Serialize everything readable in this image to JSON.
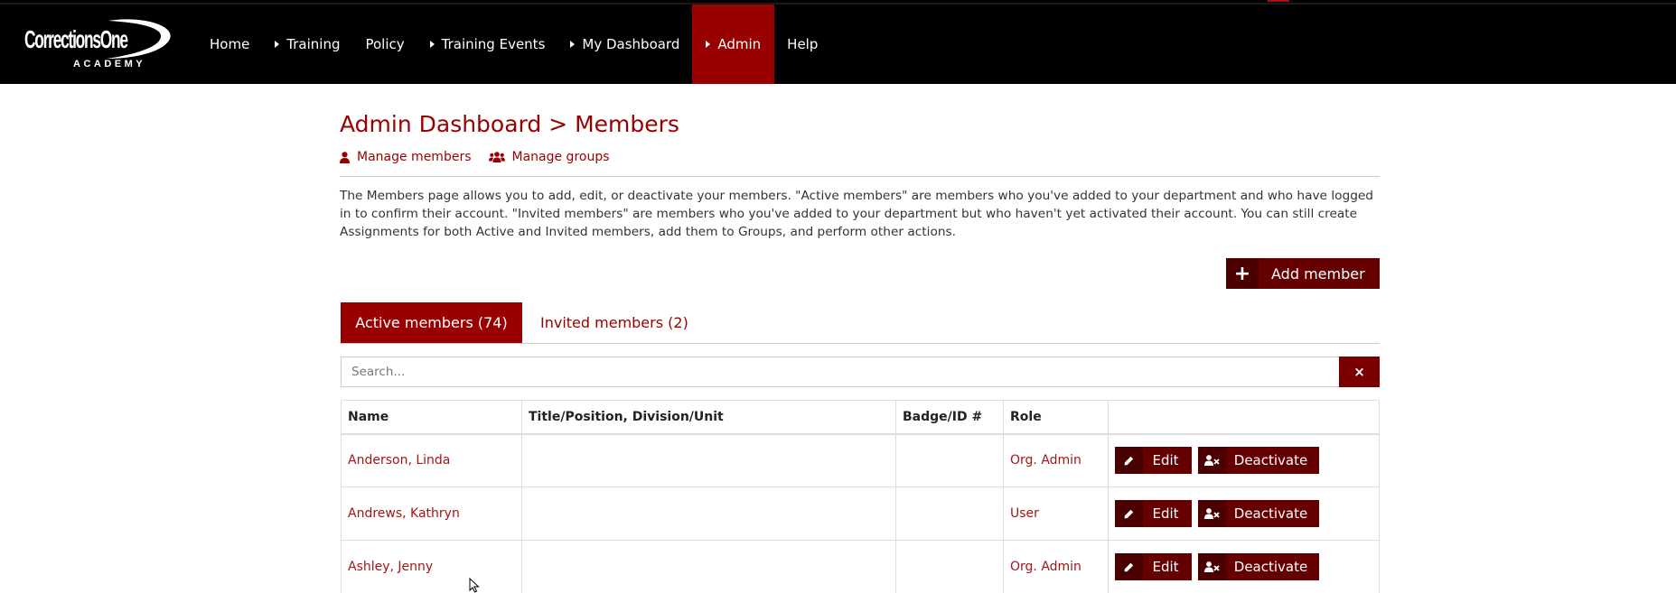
{
  "brand": {
    "name": "CorrectionsOne",
    "sub": "ACADEMY"
  },
  "nav": {
    "items": [
      {
        "label": "Home",
        "caret": false,
        "active": false
      },
      {
        "label": "Training",
        "caret": true,
        "active": false
      },
      {
        "label": "Policy",
        "caret": false,
        "active": false
      },
      {
        "label": "Training Events",
        "caret": true,
        "active": false
      },
      {
        "label": "My Dashboard",
        "caret": true,
        "active": false
      },
      {
        "label": "Admin",
        "caret": true,
        "active": true
      },
      {
        "label": "Help",
        "caret": false,
        "active": false
      }
    ]
  },
  "page": {
    "title": "Admin Dashboard > Members",
    "subnav": {
      "manage_members": "Manage members",
      "manage_groups": "Manage groups"
    },
    "description": "The Members page allows you to add, edit, or deactivate your members. \"Active members\" are members who you've added to your department and who have logged in to confirm their account. \"Invited members\" are members who you've added to your department but who haven't yet activated their account. You can still create Assignments for both Active and Invited members, add them to Groups, and perform other actions.",
    "add_button": "Add member"
  },
  "tabs": {
    "active": "Active members (74)",
    "invited": "Invited members (2)"
  },
  "search": {
    "placeholder": "Search...",
    "clear": "×"
  },
  "table": {
    "headers": {
      "name": "Name",
      "title": "Title/Position, Division/Unit",
      "badge": "Badge/ID #",
      "role": "Role",
      "actions": ""
    },
    "edit_label": "Edit",
    "deactivate_label": "Deactivate",
    "rows": [
      {
        "name": "Anderson, Linda",
        "title": "",
        "badge": "",
        "role": "Org. Admin"
      },
      {
        "name": "Andrews, Kathryn",
        "title": "",
        "badge": "",
        "role": "User"
      },
      {
        "name": "Ashley, Jenny",
        "title": "",
        "badge": "",
        "role": "Org. Admin"
      }
    ]
  },
  "colors": {
    "accent": "#990000",
    "button": "#660000",
    "button_icon_bg": "#4a0000",
    "link": "#a31515",
    "topbar": "#000000"
  }
}
